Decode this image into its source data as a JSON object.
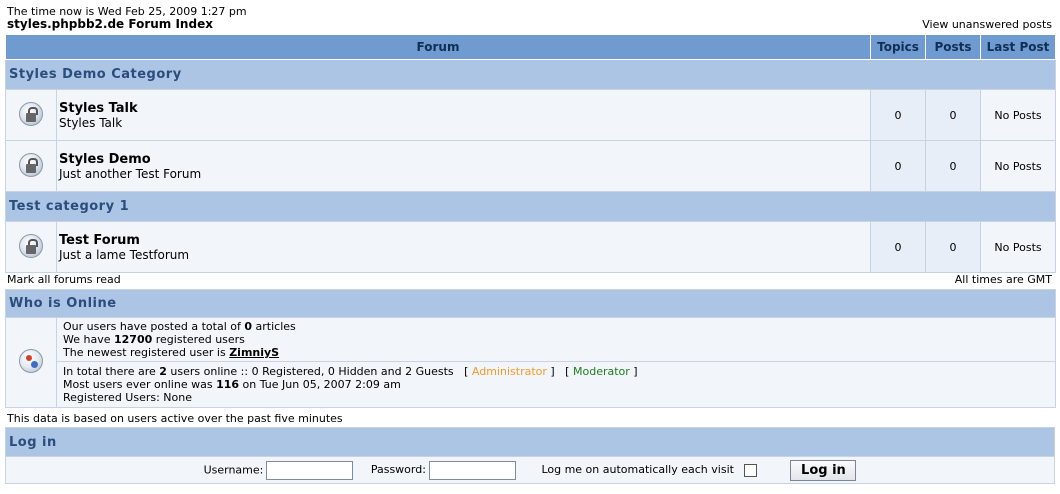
{
  "header": {
    "time_line": "The time now is Wed Feb 25, 2009 1:27 pm",
    "index_link": "styles.phpbb2.de Forum Index",
    "unanswered_link": "View unanswered posts"
  },
  "forum_table": {
    "columns": [
      "Forum",
      "Topics",
      "Posts",
      "Last Post"
    ],
    "categories": [
      {
        "name": "Styles Demo Category",
        "forums": [
          {
            "name": "Styles Talk",
            "desc": "Styles Talk",
            "topics": "0",
            "posts": "0",
            "last_post": "No Posts",
            "icon": "locked-forum-icon"
          },
          {
            "name": "Styles Demo",
            "desc": "Just another Test Forum",
            "topics": "0",
            "posts": "0",
            "last_post": "No Posts",
            "icon": "locked-forum-icon"
          }
        ]
      },
      {
        "name": "Test category 1",
        "forums": [
          {
            "name": "Test Forum",
            "desc": "Just a lame Testforum",
            "topics": "0",
            "posts": "0",
            "last_post": "No Posts",
            "icon": "locked-forum-icon"
          }
        ]
      }
    ]
  },
  "below_forums": {
    "mark_read": "Mark all forums read",
    "times": "All times are GMT"
  },
  "who_online": {
    "title": "Who is Online",
    "l1_pre": "Our users have posted a total of ",
    "l1_num": "0",
    "l1_post": " articles",
    "l2_pre": "We have ",
    "l2_num": "12700",
    "l2_post": " registered users",
    "l3_pre": "The newest registered user is ",
    "l3_user": "ZimniyS",
    "l4_pre": "In total there are ",
    "l4_num": "2",
    "l4_post": " users online :: 0 Registered, 0 Hidden and 2 Guests   [ ",
    "admin": "Administrator",
    "l4_mid": " ]   [ ",
    "mod": "Moderator",
    "l4_end": " ]",
    "l5_pre": "Most users ever online was ",
    "l5_num": "116",
    "l5_post": " on Tue Jun 05, 2007 2:09 am",
    "l6": "Registered Users: None",
    "admin_color": "#f39b2a",
    "mod_color": "#1e7d22"
  },
  "data_note": "This data is based on users active over the past five minutes",
  "login": {
    "title": "Log in",
    "username_label": "Username:",
    "password_label": "Password:",
    "auto_label": "Log me on automatically each visit",
    "button": "Log in"
  }
}
